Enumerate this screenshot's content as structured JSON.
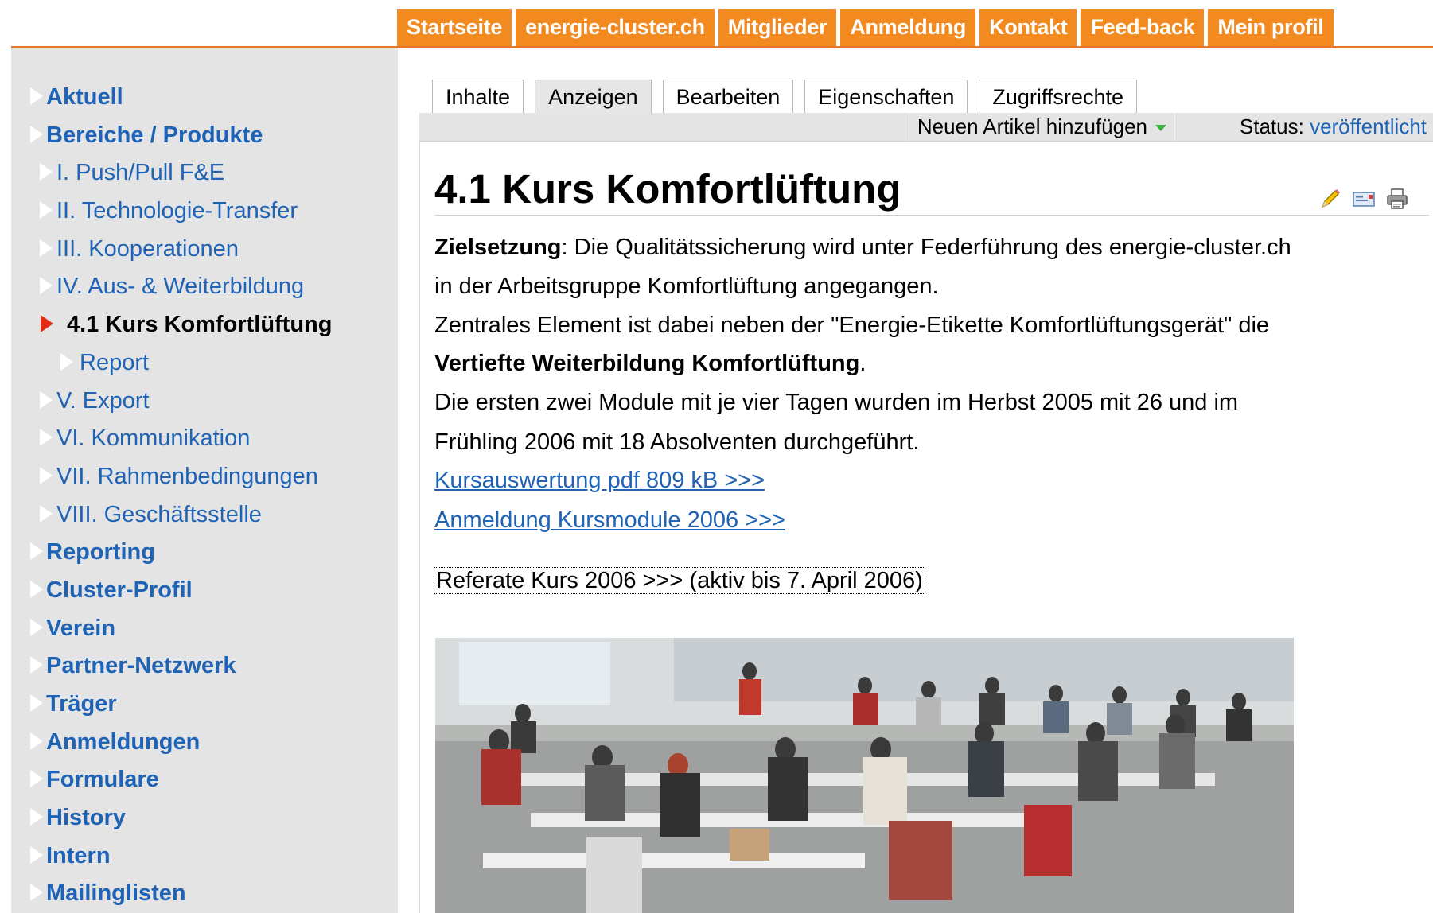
{
  "topnav": [
    "Startseite",
    "energie-cluster.ch",
    "Mitglieder",
    "Anmeldung",
    "Kontakt",
    "Feed-back",
    "Mein profil"
  ],
  "sidebar": [
    {
      "label": "Aktuell",
      "level": 0
    },
    {
      "label": "Bereiche / Produkte",
      "level": 0
    },
    {
      "label": "I. Push/Pull F&E",
      "level": 1
    },
    {
      "label": "II. Technologie-Transfer",
      "level": 1
    },
    {
      "label": "III. Kooperationen",
      "level": 1
    },
    {
      "label": "IV. Aus- & Weiterbildung",
      "level": 1
    },
    {
      "label": "4.1 Kurs Komfortlüftung",
      "level": 1,
      "active": true
    },
    {
      "label": "Report",
      "level": 2
    },
    {
      "label": "V. Export",
      "level": 1
    },
    {
      "label": "VI. Kommunikation",
      "level": 1
    },
    {
      "label": "VII. Rahmenbedingungen",
      "level": 1
    },
    {
      "label": "VIII. Geschäftsstelle",
      "level": 1
    },
    {
      "label": "Reporting",
      "level": 0
    },
    {
      "label": "Cluster-Profil",
      "level": 0
    },
    {
      "label": "Verein",
      "level": 0
    },
    {
      "label": "Partner-Netzwerk",
      "level": 0
    },
    {
      "label": "Träger",
      "level": 0
    },
    {
      "label": "Anmeldungen",
      "level": 0
    },
    {
      "label": "Formulare",
      "level": 0
    },
    {
      "label": "History",
      "level": 0
    },
    {
      "label": "Intern",
      "level": 0
    },
    {
      "label": "Mailinglisten",
      "level": 0
    }
  ],
  "tabs": [
    {
      "label": "Inhalte"
    },
    {
      "label": "Anzeigen",
      "active": true
    },
    {
      "label": "Bearbeiten"
    },
    {
      "label": "Eigenschaften"
    },
    {
      "label": "Zugriffsrechte"
    }
  ],
  "toolbar": {
    "add_label": "Neuen Artikel hinzufügen",
    "status_label": "Status:",
    "status_value": "veröffentlicht"
  },
  "icons": [
    "edit-pencil-icon",
    "email-icon",
    "print-icon"
  ],
  "article": {
    "title": "4.1 Kurs Komfortlüftung",
    "p1_bold": "Zielsetzung",
    "p1_rest": ": Die Qualitätssicherung wird unter Federführung des energie-cluster.ch",
    "p1_line2": "in der Arbeitsgruppe Komfortlüftung angegangen.",
    "p2": "Zentrales Element ist dabei neben der \"Energie-Etikette Komfortlüftungsgerät\" die",
    "p2_bold": "Vertiefte Weiterbildung Komfortlüftung",
    "p2_end": ".",
    "p3_line1": "Die ersten zwei Module mit je vier Tagen wurden im Herbst 2005 mit 26 und im",
    "p3_line2": "Frühling 2006 mit 18 Absolventen durchgeführt.",
    "link1": "Kursauswertung pdf 809 kB >>>",
    "link2": "Anmeldung Kursmodule 2006 >>>",
    "link3": "Referate Kurs 2006 >>> (aktiv bis 7. April 2006)"
  },
  "colors": {
    "accent": "#f38a1f",
    "link": "#1f63b6",
    "active_arrow": "#e32b14",
    "sidebar_bg": "#e4e4e4"
  }
}
